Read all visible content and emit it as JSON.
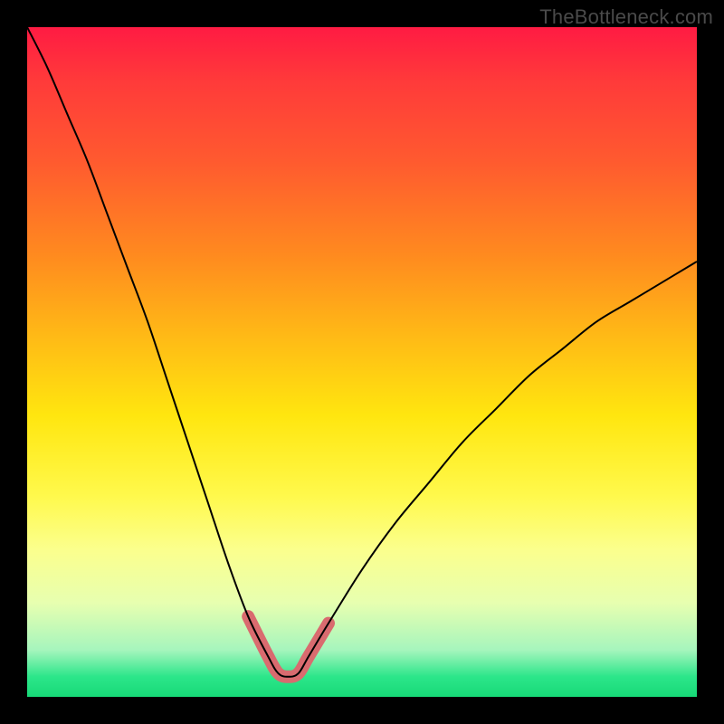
{
  "watermark": "TheBottleneck.com",
  "colors": {
    "frame_bg": "#000000",
    "curve": "#000000",
    "highlight": "#d96b6f",
    "gradient_top": "#ff1b43",
    "gradient_mid": "#ffe60f",
    "gradient_bottom": "#17d977"
  },
  "chart_data": {
    "type": "line",
    "title": "",
    "xlabel": "",
    "ylabel": "",
    "xlim": [
      0,
      100
    ],
    "ylim": [
      0,
      100
    ],
    "grid": false,
    "note": "Values estimated from pixel positions; y=0 is bottom of plot, y=100 is top. Curve is a V-shaped bottleneck profile with minimum near x≈39.",
    "series": [
      {
        "name": "bottleneck-curve",
        "x": [
          0,
          3,
          6,
          9,
          12,
          15,
          18,
          21,
          24,
          27,
          30,
          33,
          36,
          37.5,
          39,
          40.5,
          42,
          45,
          50,
          55,
          60,
          65,
          70,
          75,
          80,
          85,
          90,
          95,
          100
        ],
        "y": [
          100,
          94,
          87,
          80,
          72,
          64,
          56,
          47,
          38,
          29,
          20,
          12,
          6,
          3.5,
          3,
          3.5,
          6,
          11,
          19,
          26,
          32,
          38,
          43,
          48,
          52,
          56,
          59,
          62,
          65
        ]
      },
      {
        "name": "optimal-band-highlight",
        "x": [
          33,
          36,
          37.5,
          39,
          40.5,
          42,
          45
        ],
        "y": [
          12,
          6,
          3.5,
          3,
          3.5,
          6,
          11
        ]
      }
    ],
    "background_gradient": {
      "orientation": "vertical",
      "stops": [
        {
          "pos": 0.0,
          "color": "#ff1b43"
        },
        {
          "pos": 0.08,
          "color": "#ff3a3a"
        },
        {
          "pos": 0.2,
          "color": "#ff5a2f"
        },
        {
          "pos": 0.34,
          "color": "#ff8a1f"
        },
        {
          "pos": 0.46,
          "color": "#ffb916"
        },
        {
          "pos": 0.58,
          "color": "#ffe60f"
        },
        {
          "pos": 0.7,
          "color": "#fff94c"
        },
        {
          "pos": 0.78,
          "color": "#fbff8d"
        },
        {
          "pos": 0.86,
          "color": "#e7ffb0"
        },
        {
          "pos": 0.93,
          "color": "#a6f5bd"
        },
        {
          "pos": 0.97,
          "color": "#2ce68a"
        },
        {
          "pos": 1.0,
          "color": "#17d977"
        }
      ]
    }
  }
}
